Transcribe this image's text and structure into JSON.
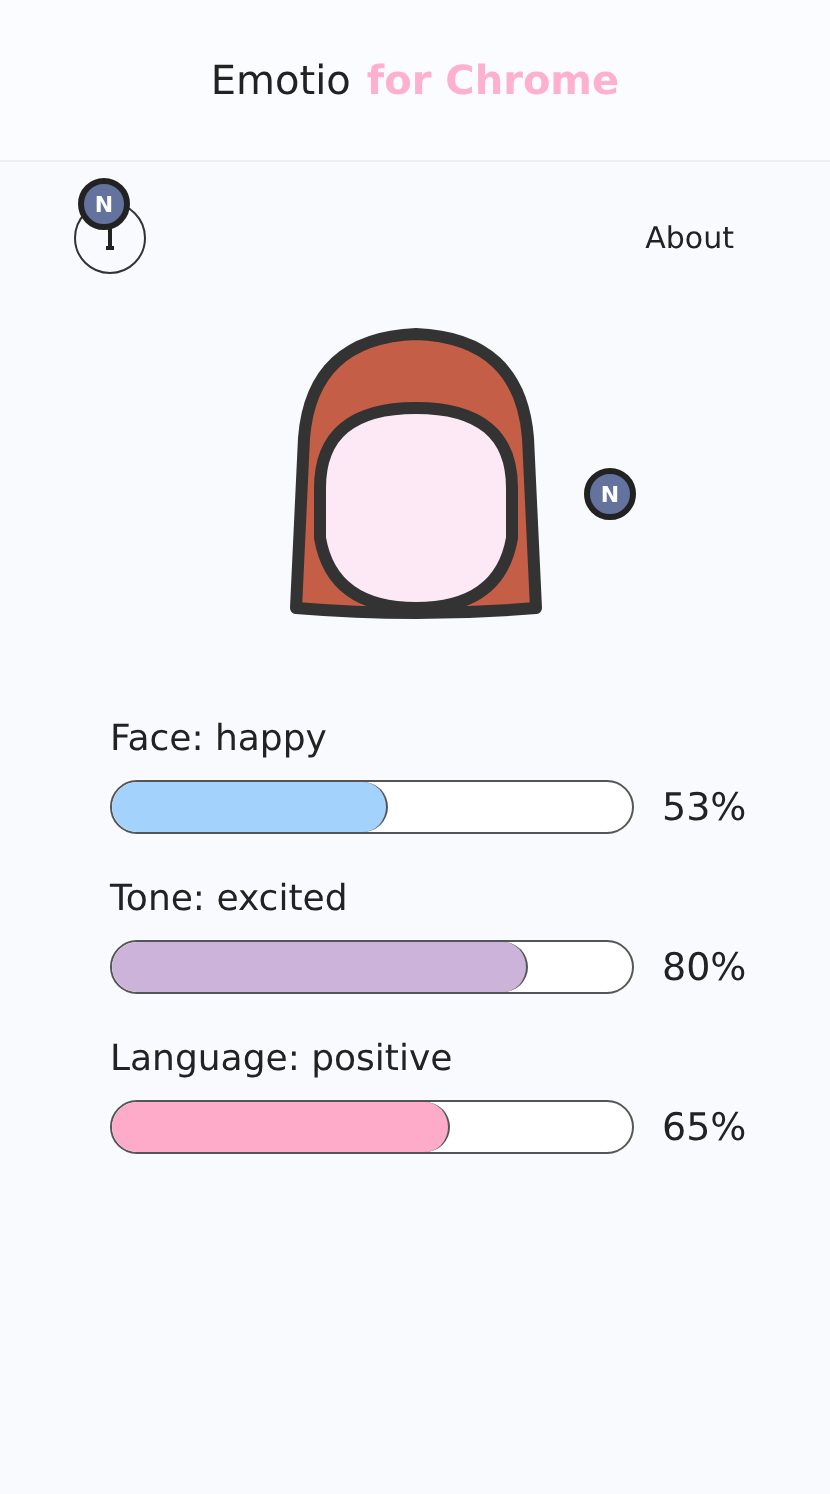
{
  "header": {
    "title": "Emotio",
    "subtitle": "for Chrome"
  },
  "nav": {
    "about": "About"
  },
  "badges": [
    {
      "label": "N"
    },
    {
      "label": "N"
    }
  ],
  "meters": [
    {
      "label": "Face: happy",
      "level": 0.53,
      "reading": "53%",
      "color": "#a3d2fd"
    },
    {
      "label": "Tone: excited",
      "level": 0.8,
      "reading": "80%",
      "color": "#cbb3d9"
    },
    {
      "label": "Language: positive",
      "level": 0.65,
      "reading": "65%",
      "color": "#fdabc8"
    }
  ]
}
